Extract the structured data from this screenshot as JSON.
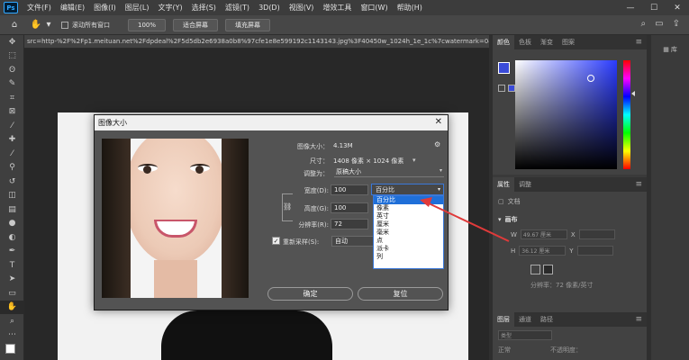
{
  "app": {
    "logo": "Ps",
    "menu": [
      "文件(F)",
      "编辑(E)",
      "图像(I)",
      "图层(L)",
      "文字(Y)",
      "选择(S)",
      "滤镜(T)",
      "3D(D)",
      "视图(V)",
      "增效工具",
      "窗口(W)",
      "帮助(H)"
    ],
    "window_controls": [
      "—",
      "☐",
      "✕"
    ]
  },
  "options_bar": {
    "scroll_all_label": "滚动所有窗口",
    "zoom_100": "100%",
    "fit_screen": "适合屏幕",
    "fill_screen": "填充屏幕"
  },
  "document": {
    "tab_title": "src=http-%2F%2Fp1.meituan.net%2Fdpdeal%2F5d5db2e6938a0b8%97cfe1e8e599192c1143143.jpg%3F40450w_1024h_1e_1c%7cwatermark=0&refer="
  },
  "color_panel": {
    "tabs": [
      "颜色",
      "色板",
      "渐变",
      "图案"
    ],
    "fg_color": "#3a4bd8",
    "bg_color": "#ffffff"
  },
  "properties_panel": {
    "tabs": [
      "属性",
      "调整"
    ],
    "doc_label": "文档",
    "section": "画布",
    "w_label": "W",
    "h_label": "H",
    "w_value": "49.67 厘米",
    "h_value": "36.12 厘米",
    "x_label": "X",
    "y_label": "Y",
    "resolution": "分辨率：72 像素/英寸"
  },
  "layers_panel": {
    "tabs": [
      "图层",
      "通道",
      "路径"
    ],
    "search_placeholder": "类型",
    "mode": "正常",
    "opacity_label": "不透明度："
  },
  "far_panel": {
    "label": "库"
  },
  "dialog": {
    "title": "图像大小",
    "close": "✕",
    "image_size_label": "图像大小：",
    "image_size_value": "4.13M",
    "dimension_label": "尺寸：",
    "dimension_value": "1408 像素 × 1024 像素",
    "fit_label": "调整为：",
    "fit_value": "原稿大小",
    "width_label": "宽度(D):",
    "width_value": "100",
    "width_unit": "百分比",
    "height_label": "高度(G):",
    "height_value": "100",
    "resolution_label": "分辨率(R):",
    "resolution_value": "72",
    "resample_label": "重新采样(S):",
    "resample_value": "自动",
    "ok_button": "确定",
    "reset_button": "复位",
    "unit_options": [
      "百分比",
      "像素",
      "英寸",
      "厘米",
      "毫米",
      "点",
      "派卡",
      "列"
    ],
    "selected_unit": "百分比"
  }
}
